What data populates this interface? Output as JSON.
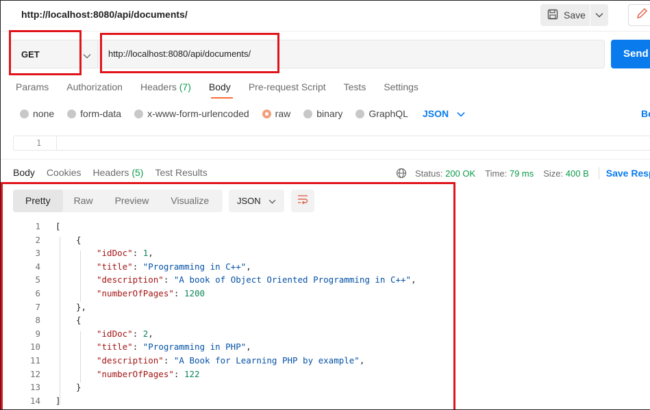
{
  "tab": {
    "title": "http://localhost:8080/api/documents/"
  },
  "toolbar": {
    "save_label": "Save"
  },
  "request": {
    "method": "GET",
    "url": "http://localhost:8080/api/documents/",
    "send_label": "Send"
  },
  "request_tabs": [
    {
      "label": "Params"
    },
    {
      "label": "Authorization"
    },
    {
      "label": "Headers",
      "count": "(7)"
    },
    {
      "label": "Body"
    },
    {
      "label": "Pre-request Script"
    },
    {
      "label": "Tests"
    },
    {
      "label": "Settings"
    }
  ],
  "body_types": [
    {
      "label": "none"
    },
    {
      "label": "form-data"
    },
    {
      "label": "x-www-form-urlencoded"
    },
    {
      "label": "raw"
    },
    {
      "label": "binary"
    },
    {
      "label": "GraphQL"
    }
  ],
  "body_format": "JSON",
  "beautify_label": "Be",
  "request_editor": {
    "line": "1"
  },
  "response_tabs": [
    {
      "label": "Body"
    },
    {
      "label": "Cookies"
    },
    {
      "label": "Headers",
      "count": "(5)"
    },
    {
      "label": "Test Results"
    }
  ],
  "response_meta": {
    "status_label": "Status:",
    "status_value": "200 OK",
    "time_label": "Time:",
    "time_value": "79 ms",
    "size_label": "Size:",
    "size_value": "400 B",
    "save_response": "Save Resp"
  },
  "view_modes": [
    {
      "label": "Pretty"
    },
    {
      "label": "Raw"
    },
    {
      "label": "Preview"
    },
    {
      "label": "Visualize"
    }
  ],
  "response_format": "JSON",
  "response_body": [
    {
      "num": "1",
      "text": "["
    },
    {
      "num": "2",
      "text": "{"
    },
    {
      "num": "3",
      "key": "\"idDoc\"",
      "value": "1",
      "vtype": "n",
      "comma": ","
    },
    {
      "num": "4",
      "key": "\"title\"",
      "value": "\"Programming in C++\"",
      "vtype": "s",
      "comma": ","
    },
    {
      "num": "5",
      "key": "\"description\"",
      "value": "\"A book of Object Oriented Programming in C++\"",
      "vtype": "s",
      "comma": ","
    },
    {
      "num": "6",
      "key": "\"numberOfPages\"",
      "value": "1200",
      "vtype": "n",
      "comma": ""
    },
    {
      "num": "7",
      "text": "},"
    },
    {
      "num": "8",
      "text": "{"
    },
    {
      "num": "9",
      "key": "\"idDoc\"",
      "value": "2",
      "vtype": "n",
      "comma": ","
    },
    {
      "num": "10",
      "key": "\"title\"",
      "value": "\"Programming in PHP\"",
      "vtype": "s",
      "comma": ","
    },
    {
      "num": "11",
      "key": "\"description\"",
      "value": "\"A Book for Learning PHP by example\"",
      "vtype": "s",
      "comma": ","
    },
    {
      "num": "12",
      "key": "\"numberOfPages\"",
      "value": "122",
      "vtype": "n",
      "comma": ""
    },
    {
      "num": "13",
      "text": "}"
    },
    {
      "num": "14",
      "text": "]"
    }
  ]
}
